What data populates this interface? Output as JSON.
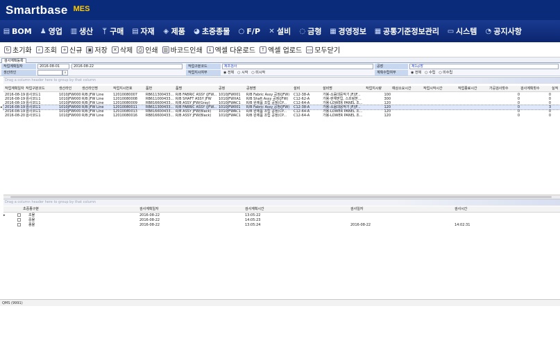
{
  "app": {
    "brand": "Smartbase",
    "brand_suffix": "MES"
  },
  "menu": [
    {
      "icon": "▤",
      "icon_name": "monitor-icon",
      "label": "BOM"
    },
    {
      "icon": "♟",
      "icon_name": "people-icon",
      "label": "영업"
    },
    {
      "icon": "▥",
      "icon_name": "chart-icon",
      "label": "생산"
    },
    {
      "icon": "ᛘ",
      "icon_name": "cart-icon",
      "label": "구매"
    },
    {
      "icon": "▤",
      "icon_name": "document-icon",
      "label": "자재"
    },
    {
      "icon": "◈",
      "icon_name": "box-icon",
      "label": "제품"
    },
    {
      "icon": "◕",
      "icon_name": "pie-icon",
      "label": "초중종물"
    },
    {
      "icon": "○",
      "icon_name": "circle-icon",
      "label": "F/P"
    },
    {
      "icon": "✕",
      "icon_name": "tools-icon",
      "label": "설비"
    },
    {
      "icon": "◌",
      "icon_name": "mold-icon",
      "label": "금형"
    },
    {
      "icon": "▦",
      "icon_name": "calendar-icon",
      "label": "경영정보"
    },
    {
      "icon": "▦",
      "icon_name": "grid-icon",
      "label": "공통기준정보관리"
    },
    {
      "icon": "▭",
      "icon_name": "monitor-icon",
      "label": "시스템"
    },
    {
      "icon": "◔",
      "icon_name": "clock-icon",
      "label": "공지사항"
    }
  ],
  "toolbar": [
    {
      "icon": "↻",
      "icon_name": "reset-icon",
      "label": "초기화"
    },
    {
      "icon": "⌕",
      "icon_name": "search-icon",
      "label": "조회"
    },
    {
      "icon": "+",
      "icon_name": "new-icon",
      "label": "신규"
    },
    {
      "icon": "▣",
      "icon_name": "save-icon",
      "label": "저장"
    },
    {
      "icon": "✕",
      "icon_name": "delete-icon",
      "label": "삭제"
    },
    {
      "icon": "⎙",
      "icon_name": "print-icon",
      "label": "인쇄"
    },
    {
      "icon": "▥",
      "icon_name": "barcode-icon",
      "label": "바코드인쇄"
    },
    {
      "icon": "↓",
      "icon_name": "excel-download-icon",
      "label": "엑셀 다운로드"
    },
    {
      "icon": "↑",
      "icon_name": "excel-upload-icon",
      "label": "엑셀 업로드"
    },
    {
      "icon": "▭",
      "icon_name": "close-all-icon",
      "label": "모두닫기"
    }
  ],
  "tab_label": "검사계획등록",
  "filters": {
    "plan_date_label": "작업계획일자",
    "date_from": "2016-08-01",
    "date_to": "2016-08-22",
    "work_type_label": "작업구분코드",
    "work_type_value": "제조검사",
    "factory_label": "공장",
    "factory_value": "제1공장",
    "product_label": "생산라인",
    "process_label": "작업지시여부",
    "process_options": [
      "전체",
      "시작",
      "미시작"
    ],
    "register_label": "계획수립여부",
    "register_options": [
      "전체",
      "수립",
      "미수립"
    ]
  },
  "grid1": {
    "group_hint": "Drag a column header here to group by that column",
    "columns": [
      "작업계획일자",
      "작업구분코드",
      "생산라인",
      "생산라인명",
      "작업지시번호",
      "품번",
      "품명",
      "공정",
      "공정명",
      "설비",
      "설비명",
      "작업지시량",
      "예상소요시간",
      "작업시작시간",
      "작업종료시간",
      "가공검사횟수",
      "검사계획횟수",
      "실적"
    ],
    "rows": [
      [
        "2016-08-19",
        "검사코드1",
        "1010JFW000",
        "R/B JFW Line",
        "12010080007",
        "RB611300433...",
        "R/B FABRIC ASSY (JFW...",
        "1010JFW001",
        "R/B Fabric Assy 공정(JFW)",
        "C12-38-A",
        "가봉-소음대응작기 JF/JF...",
        "100",
        "",
        "",
        "",
        "0",
        "0",
        ""
      ],
      [
        "2016-08-19",
        "검사코드1",
        "1010JFW000",
        "R/B JFW Line",
        "12010080008",
        "RB611000433...",
        "R/B SHAFT ASSY JFW",
        "1010JFWXA1",
        "R/B Shaft Assy 공정(JFW)",
        "C12-62-A",
        "가봉-판재받입, 스프링받...",
        "300",
        "",
        "",
        "",
        "0",
        "0",
        ""
      ],
      [
        "2016-08-19",
        "검사코드1",
        "1010JFW000",
        "R/B JFW Line",
        "12010080009",
        "RB816600433...",
        "R/B ASSY JFW(Gray)",
        "1010JFWAC1",
        "R/B 완제품 조립 공정(CP...",
        "C12-64-A",
        "가봉-LOWER PANEL 조...",
        "120",
        "",
        "",
        "",
        "0",
        "0",
        ""
      ],
      [
        "2016-08-19",
        "검사코드1",
        "1010JFW000",
        "R/B JFW Line",
        "12010080011",
        "RB611300433...",
        "R/B FABRIC ASSY (JFW...",
        "1010JFW001",
        "R/B Fabric Assy 공정(JFW)",
        "C12-38-A",
        "가봉-소음대응작기 JF/JF...",
        "120",
        "",
        "",
        "",
        "0",
        "3",
        ""
      ],
      [
        "2016-08-19",
        "검사코드1",
        "1010JFW000",
        "R/B JFW Line",
        "12010080013",
        "RB816600433...",
        "R/B ASSY JFW(Black)",
        "1010JFWAC1",
        "R/B 완제품 조립 공정(CP...",
        "C12-64-A",
        "가봉-LOWER PANEL 조...",
        "120",
        "",
        "",
        "",
        "0",
        "0",
        ""
      ],
      [
        "2016-08-20",
        "검사코드1",
        "1010JFW000",
        "R/B JFW Line",
        "12010080016",
        "RB816600433...",
        "R/B ASSY JFW(Black)",
        "1010JFWAC1",
        "R/B 완제품 조립 공정(CP...",
        "C12-64-A",
        "가봉-LOWER PANEL 조...",
        "120",
        "",
        "",
        "",
        "0",
        "0",
        ""
      ]
    ],
    "selected_index": 3
  },
  "grid2": {
    "group_hint": "Drag a column header here to group by that column",
    "columns": [
      "초중종구분",
      "검사계획일자",
      "검사계획시간",
      "검사일자",
      "검사시간"
    ],
    "rows": [
      [
        "초물",
        "2016-08-22",
        "13:05:22",
        "",
        ""
      ],
      [
        "중물",
        "2016-08-22",
        "14:05:23",
        "",
        ""
      ],
      [
        "종물",
        "2016-08-22",
        "13:05:24",
        "2016-08-22",
        "14:02:31"
      ]
    ],
    "selected_index": 0
  },
  "status": "QMS (9991)"
}
